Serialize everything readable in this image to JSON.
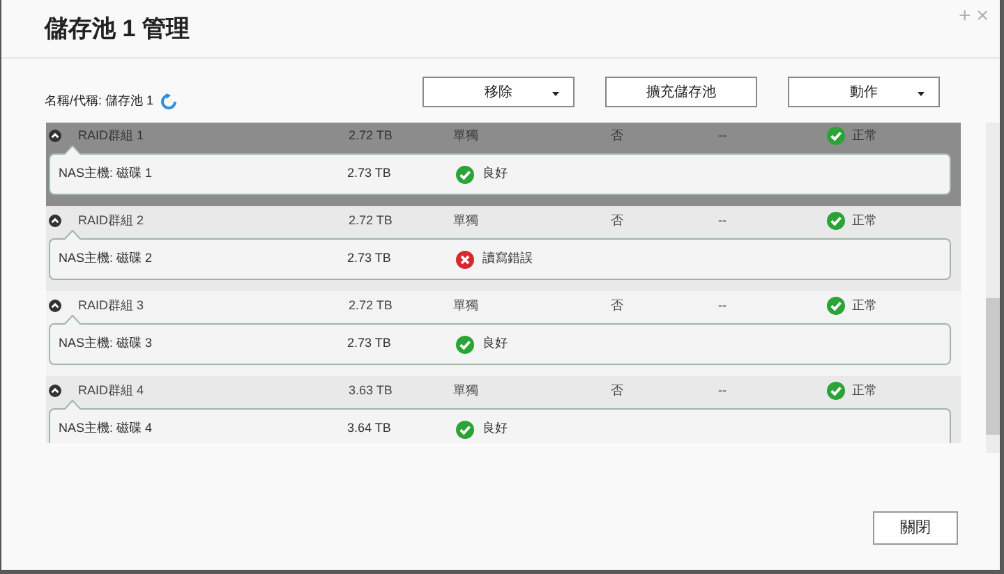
{
  "dialog": {
    "title": "儲存池 1 管理",
    "header_icons": [
      "+",
      "×"
    ]
  },
  "toolbar": {
    "name_label": "名稱/代稱: 儲存池 1",
    "buttons": [
      {
        "label": "移除",
        "dropdown": true
      },
      {
        "label": "擴充儲存池",
        "dropdown": false
      },
      {
        "label": "動作",
        "dropdown": true
      }
    ]
  },
  "groups": [
    {
      "name": "RAID群組 1",
      "capacity": "2.72 TB",
      "type": "單獨",
      "column_4": "否",
      "column_5": "--",
      "status": {
        "text": "正常",
        "kind": "ok"
      },
      "selected": true,
      "expanded": true,
      "disks": [
        {
          "name": "NAS主機: 磁碟 1",
          "capacity": "2.73 TB",
          "status": {
            "text": "良好",
            "kind": "ok"
          }
        }
      ]
    },
    {
      "name": "RAID群組 2",
      "capacity": "2.72 TB",
      "type": "單獨",
      "column_4": "否",
      "column_5": "--",
      "status": {
        "text": "正常",
        "kind": "ok"
      },
      "selected": false,
      "expanded": true,
      "disks": [
        {
          "name": "NAS主機: 磁碟 2",
          "capacity": "2.73 TB",
          "status": {
            "text": "讀寫錯誤",
            "kind": "error"
          }
        }
      ]
    },
    {
      "name": "RAID群組 3",
      "capacity": "2.72 TB",
      "type": "單獨",
      "column_4": "否",
      "column_5": "--",
      "status": {
        "text": "正常",
        "kind": "ok"
      },
      "selected": false,
      "expanded": true,
      "disks": [
        {
          "name": "NAS主機: 磁碟 3",
          "capacity": "2.73 TB",
          "status": {
            "text": "良好",
            "kind": "ok"
          }
        }
      ]
    },
    {
      "name": "RAID群組 4",
      "capacity": "3.63 TB",
      "type": "單獨",
      "column_4": "否",
      "column_5": "--",
      "status": {
        "text": "正常",
        "kind": "ok"
      },
      "selected": false,
      "expanded": true,
      "disks": [
        {
          "name": "NAS主機: 磁碟 4",
          "capacity": "3.64 TB",
          "status": {
            "text": "良好",
            "kind": "ok"
          }
        }
      ]
    }
  ],
  "footer": {
    "close_button": "關閉"
  }
}
